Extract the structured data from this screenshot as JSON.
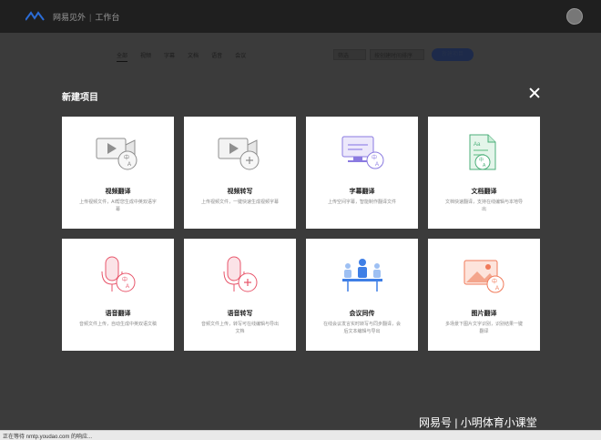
{
  "app": {
    "brand_name": "网易见外",
    "brand_section": "工作台"
  },
  "background_tabs": [
    "全部",
    "视频",
    "字幕",
    "文档",
    "语音",
    "会议"
  ],
  "background_controls": {
    "select_1": "筛选",
    "select_2": "按创建时间排序",
    "new_button": "新建项目"
  },
  "modal": {
    "title": "新建项目",
    "cards": [
      {
        "title": "视频翻译",
        "desc": "上传视频文件，AI帮您生成中英双语字幕",
        "icon": "video-translate-icon"
      },
      {
        "title": "视频转写",
        "desc": "上传视频文件，一键快速生成视频字幕",
        "icon": "video-transcribe-icon"
      },
      {
        "title": "字幕翻译",
        "desc": "上传空间字幕，智能制作翻译文件",
        "icon": "subtitle-translate-icon"
      },
      {
        "title": "文档翻译",
        "desc": "文档快速翻译，支持在线编辑与本地导出",
        "icon": "document-translate-icon"
      },
      {
        "title": "语音翻译",
        "desc": "音频文件上传，自动生成中英双语文稿",
        "icon": "voice-translate-icon"
      },
      {
        "title": "语音转写",
        "desc": "音频文件上传，转写可在线编辑与导出文档",
        "icon": "voice-transcribe-icon"
      },
      {
        "title": "会议同传",
        "desc": "在线会议发言实时转写与同步翻译，会后文本编辑与导出",
        "icon": "meeting-interpret-icon"
      },
      {
        "title": "图片翻译",
        "desc": "多场景下图片文字识别，识别结果一键翻译",
        "icon": "image-translate-icon"
      }
    ]
  },
  "status_bar": "正在等待 nmtp.youdao.com 的响应...",
  "watermark": "网易号 | 小明体育小课堂",
  "colors": {
    "card_bg": "#ffffff",
    "accent_red": "#e8566b",
    "accent_purple": "#8a7ae0",
    "accent_green": "#4caf7a",
    "accent_blue": "#3f7fe6"
  }
}
